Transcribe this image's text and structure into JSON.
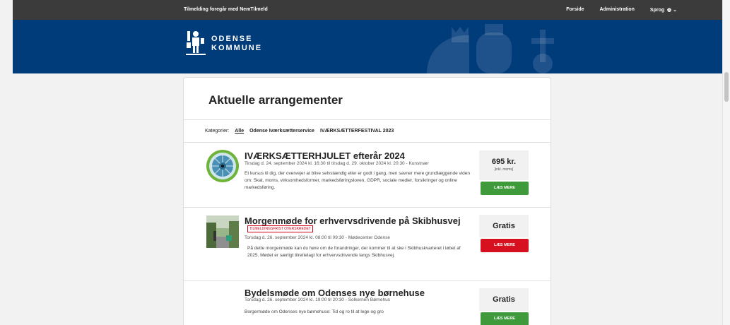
{
  "topbar": {
    "notice": "Tilmelding foregår med NemTilmeld",
    "forside": "Forside",
    "administration": "Administration",
    "sprog": "Sprog"
  },
  "brand": {
    "line1": "ODENSE",
    "line2": "KOMMUNE",
    "color": "#003b7a"
  },
  "main": {
    "title": "Aktuelle arrangementer",
    "categories_label": "Kategorier:",
    "categories": [
      "Alle",
      "Odense Iværksætterservice",
      "IVÆRKSÆTTERFESTIVAL 2023"
    ]
  },
  "events": [
    {
      "title": "IVÆRKSÆTTERHJULET efterår 2024",
      "date": "Tirsdag d. 24. september 2024 kl. 16:30 til tirsdag d. 29. oktober 2024 kl. 20:30 - Kunstnær",
      "description": "Et kursus til dig, der overvejer at blive selvstændig eller er godt i gang, men savner mere grundlæggende viden om: Skat, moms, virksomhedsformer, markedsføringsloven, GDPR, sociale medier, forsikringer og online markedsføring.",
      "price": "695 kr.",
      "vat": "[inkl. moms]",
      "button": "LÆS MERE"
    },
    {
      "title": "Morgenmøde for erhvervsdrivende på Skibhusvej",
      "badge": "TILMELDINGSFRIST OVERSKREDET",
      "date": "Torsdag d. 26. september 2024 kl. 08:00 til 09:30 - Mødecenter Odense",
      "description": "På dette morgenmøde kan du høre om de forandringer, der kommer til at ske i Skibhuskvarteret i løbet af 2025. Mødet er særligt tilrettelagt for erhvervsdrivende langs Skibhusvej.",
      "price": "Gratis",
      "button": "LÆS MERE"
    },
    {
      "title": "Bydelsmøde om Odenses nye børnehuse",
      "date": "Torsdag d. 26. september 2024 kl. 19:00 til 20:30 - Solkernen Børnehus",
      "description": "Borgermøde om Odenses nye børnehuse: Tid og ro til at lege og gro",
      "price": "Gratis",
      "button": "LÆS MERE"
    }
  ]
}
